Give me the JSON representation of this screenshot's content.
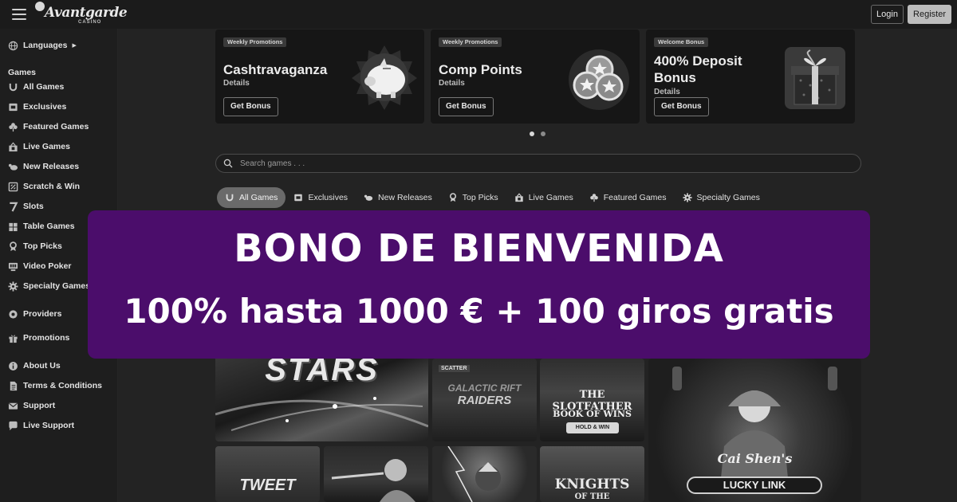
{
  "header": {
    "logo_text": "Avantgarde",
    "logo_sub": "CASINO",
    "login_label": "Login",
    "register_label": "Register"
  },
  "sidebar": {
    "languages_label": "Languages",
    "games_heading": "Games",
    "game_items": [
      {
        "label": "All Games",
        "icon": "horseshoe-icon"
      },
      {
        "label": "Exclusives",
        "icon": "exclusive-icon"
      },
      {
        "label": "Featured Games",
        "icon": "clover-icon"
      },
      {
        "label": "Live Games",
        "icon": "live-icon"
      },
      {
        "label": "New Releases",
        "icon": "new-releases-icon"
      },
      {
        "label": "Scratch & Win",
        "icon": "scratch-icon"
      },
      {
        "label": "Slots",
        "icon": "seven-icon"
      },
      {
        "label": "Table Games",
        "icon": "table-icon"
      },
      {
        "label": "Top Picks",
        "icon": "top-picks-icon"
      },
      {
        "label": "Video Poker",
        "icon": "video-poker-icon"
      },
      {
        "label": "Specialty Games",
        "icon": "gear-icon"
      }
    ],
    "providers_label": "Providers",
    "promotions_label": "Promotions",
    "info_items": [
      {
        "label": "About Us",
        "icon": "info-icon"
      },
      {
        "label": "Terms & Conditions",
        "icon": "document-icon"
      },
      {
        "label": "Support",
        "icon": "mail-icon"
      },
      {
        "label": "Live Support",
        "icon": "chat-icon"
      }
    ]
  },
  "promos": [
    {
      "tag": "Weekly Promotions",
      "title": "Cashtravaganza",
      "details": "Details",
      "button": "Get Bonus",
      "art": "piggy-bank-icon"
    },
    {
      "tag": "Weekly Promotions",
      "title": "Comp Points",
      "details": "Details",
      "button": "Get Bonus",
      "art": "star-coins-icon"
    },
    {
      "tag": "Welcome Bonus",
      "title": "400% Deposit Bonus",
      "details": "Details",
      "button": "Get Bonus",
      "art": "gift-box-icon"
    }
  ],
  "carousel": {
    "active_index": 0,
    "count": 2
  },
  "search": {
    "placeholder": "Search games . . ."
  },
  "tabs": [
    {
      "label": "All Games",
      "icon": "horseshoe-icon",
      "active": true
    },
    {
      "label": "Exclusives",
      "icon": "exclusive-icon",
      "active": false
    },
    {
      "label": "New Releases",
      "icon": "new-releases-icon",
      "active": false
    },
    {
      "label": "Top Picks",
      "icon": "top-picks-icon",
      "active": false
    },
    {
      "label": "Live Games",
      "icon": "live-icon",
      "active": false
    },
    {
      "label": "Featured Games",
      "icon": "clover-icon",
      "active": false
    },
    {
      "label": "Specialty Games",
      "icon": "gear-icon",
      "active": false
    }
  ],
  "games": {
    "stars": "STARS",
    "raiders_badge": "SCATTER",
    "raiders_top": "GALACTIC RIFT",
    "raiders_bottom": "RAIDERS",
    "slotfather_title": "THE SLOTFATHER",
    "slotfather_sub": "BOOK OF WINS",
    "slotfather_badge": "HOLD & WIN",
    "cai_shen_script": "Cai Shen's",
    "cai_shen_main": "LUCKY LINK",
    "tweety": "TWEET",
    "knights": "KNIGHTS",
    "knights_sub": "OF THE"
  },
  "banner": {
    "line1": "BONO DE BIENVENIDA",
    "line2": "100% hasta 1000 € + 100 giros gratis",
    "color": "#4b0d6b"
  }
}
